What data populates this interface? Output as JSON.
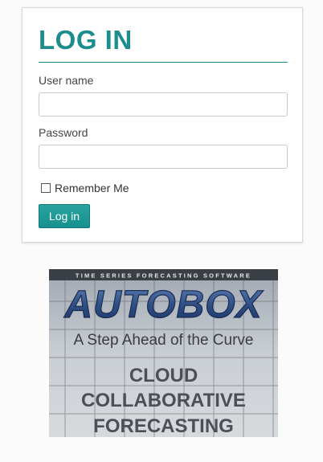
{
  "login": {
    "title": "LOG IN",
    "username_label": "User name",
    "username_value": "",
    "password_label": "Password",
    "password_value": "",
    "remember_label": "Remember Me",
    "remember_checked": false,
    "submit_label": "Log in"
  },
  "banner": {
    "tagline_top": "TIME SERIES FORECASTING SOFTWARE",
    "brand": "AUTOBOX",
    "slogan": "A Step Ahead of the Curve",
    "line1": "CLOUD",
    "line2": "COLLABORATIVE",
    "line3": "FORECASTING"
  },
  "colors": {
    "accent": "#1c8c8c",
    "button": "#15918e",
    "brand_blue": "#2f4f86"
  }
}
